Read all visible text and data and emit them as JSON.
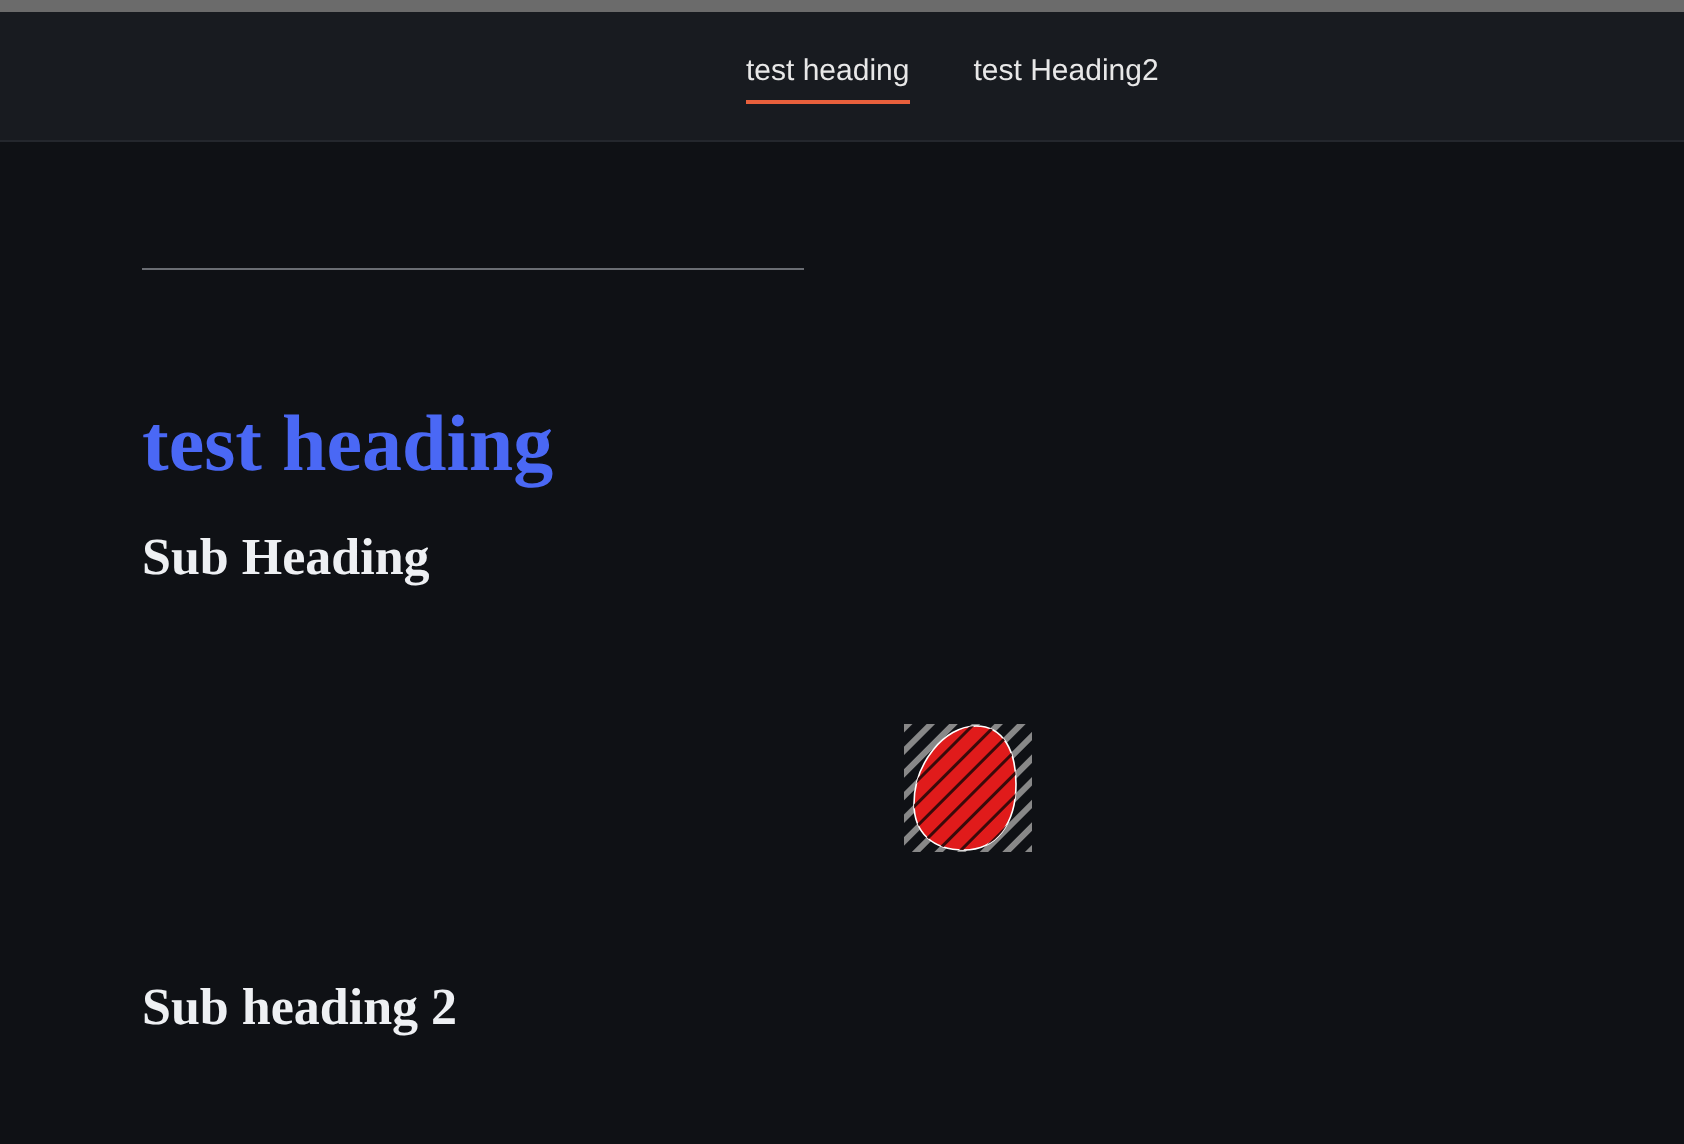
{
  "nav": {
    "tabs": [
      {
        "label": "test heading",
        "selected": true
      },
      {
        "label": "test Heading2",
        "selected": false
      }
    ]
  },
  "content": {
    "heading": "test heading",
    "subheadings": [
      "Sub Heading",
      "Sub heading 2"
    ]
  }
}
